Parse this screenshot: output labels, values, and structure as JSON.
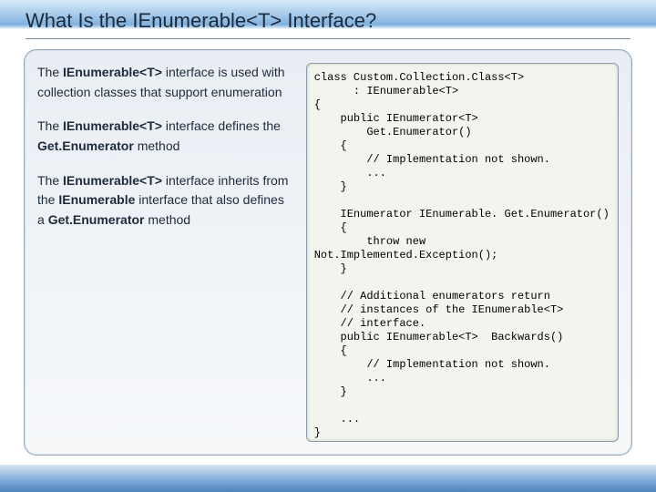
{
  "title": "What Is the IEnumerable<T> Interface?",
  "paragraphs": [
    {
      "prefix": "The ",
      "bold1": "IEnumerable<T>",
      "mid1": " interface is used with collection classes that support enumeration",
      "bold2": "",
      "mid2": "",
      "bold3": "",
      "tail": ""
    },
    {
      "prefix": "The ",
      "bold1": "IEnumerable<T>",
      "mid1": " interface defines the ",
      "bold2": "Get.Enumerator",
      "mid2": " method",
      "bold3": "",
      "tail": ""
    },
    {
      "prefix": "The ",
      "bold1": "IEnumerable<T>",
      "mid1": " interface inherits from the ",
      "bold2": "IEnumerable",
      "mid2": " interface that also defines a ",
      "bold3": "Get.Enumerator",
      "tail": " method"
    }
  ],
  "code": "class Custom.Collection.Class<T>\n      : IEnumerable<T>\n{\n    public IEnumerator<T>\n        Get.Enumerator()\n    {\n        // Implementation not shown.\n        ...\n    }\n\n    IEnumerator IEnumerable. Get.Enumerator()\n    {\n        throw new\nNot.Implemented.Exception();\n    }\n\n    // Additional enumerators return\n    // instances of the IEnumerable<T>\n    // interface.\n    public IEnumerable<T>  Backwards()\n    {\n        // Implementation not shown.\n        ...\n    }\n\n    ...\n}"
}
